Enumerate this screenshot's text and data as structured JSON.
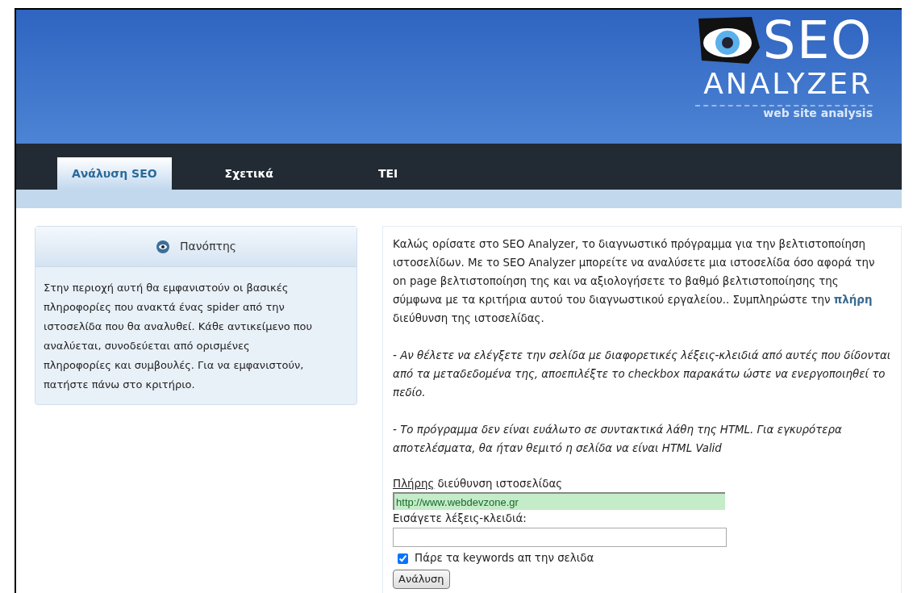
{
  "logo": {
    "title": "SEO",
    "subtitle": "ANALYZER",
    "tagline": "web site analysis"
  },
  "tabs": [
    {
      "label": "Ανάλυση SEO",
      "selected": true
    },
    {
      "label": "Σχετικά",
      "selected": false
    },
    {
      "label": "TEI",
      "selected": false
    }
  ],
  "info_panel": {
    "title": "Πανόπτης",
    "text": "Στην περιοχή αυτή θα εμφανιστούν οι βασικές πληροφορίες που ανακτά ένας spider από την ιστοσελίδα που θα αναλυθεί. Κάθε αντικείμενο που αναλύεται, συνοδεύεται από ορισμένες πληροφορίες και συμβουλές. Για να εμφανιστούν, πατήστε πάνω στο κριτήριο."
  },
  "main": {
    "intro": "Καλώς ορίσατε στο SEO Analyzer, το διαγνωστικό πρόγραμμα για την βελτιστοποίηση ιστοσελίδων. Με το SEO Analyzer μπορείτε να αναλύσετε μια ιστοσελίδα όσο αφορά την on page βελτιστοποίηση της και να αξιολογήσετε το βαθμό βελτιστοποίησης της σύμφωνα με τα κριτήρια αυτού του διαγνωστικού εργαλείου.. Συμπληρώστε την **πλήρη** διεύθυνση της ιστοσελίδας.",
    "notes": [
      "- Αν θέλετε να ελέγξετε την σελίδα με διαφορετικές λέξεις-κλειδιά από αυτές που δίδονται από τα μεταδεδομένα της, αποεπιλέξτε το checkbox παρακάτω ώστε να ενεργοποιηθεί το πεδίο.",
      "- Το πρόγραμμα δεν είναι ευάλωτο σε συντακτικά λάθη της HTML. Για εγκυρότερα αποτελέσματα, θα ήταν θεμιτό η σελίδα να είναι HTML Valid"
    ],
    "url_label_link": "Πλήρης",
    "url_label": "διεύθυνση ιστοσελίδας",
    "url_value": "http://www.webdevzone.gr",
    "keywords_label": "Εισάγετε λέξεις-κλειδιά:",
    "checkbox": {
      "label": "Πάρε τα keywords απ την σελιδα",
      "checked": true
    },
    "button": "Ανάλυση"
  }
}
